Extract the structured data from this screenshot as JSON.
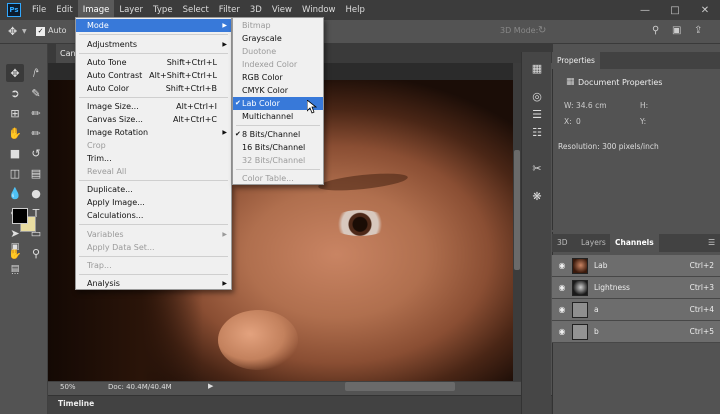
{
  "menubar": {
    "logo": "Ps",
    "items": [
      "File",
      "Edit",
      "Image",
      "Layer",
      "Type",
      "Select",
      "Filter",
      "3D",
      "View",
      "Window",
      "Help"
    ]
  },
  "options_bar": {
    "auto_label": "Auto",
    "mode_3d_label": "3D Mode:"
  },
  "document": {
    "tab_title": "Can",
    "zoom": "50%",
    "doc_size": "Doc: 40.4M/40.4M"
  },
  "image_menu": {
    "items": [
      {
        "label": "Mode",
        "shortcut": "",
        "submenu": true,
        "enabled": true,
        "highlighted": true
      },
      {
        "label": "Adjustments",
        "shortcut": "",
        "submenu": true,
        "enabled": true
      },
      {
        "label": "Auto Tone",
        "shortcut": "Shift+Ctrl+L",
        "enabled": true
      },
      {
        "label": "Auto Contrast",
        "shortcut": "Alt+Shift+Ctrl+L",
        "enabled": true
      },
      {
        "label": "Auto Color",
        "shortcut": "Shift+Ctrl+B",
        "enabled": true
      },
      {
        "label": "Image Size...",
        "shortcut": "Alt+Ctrl+I",
        "enabled": true
      },
      {
        "label": "Canvas Size...",
        "shortcut": "Alt+Ctrl+C",
        "enabled": true
      },
      {
        "label": "Image Rotation",
        "shortcut": "",
        "submenu": true,
        "enabled": true
      },
      {
        "label": "Crop",
        "shortcut": "",
        "enabled": false
      },
      {
        "label": "Trim...",
        "shortcut": "",
        "enabled": true
      },
      {
        "label": "Reveal All",
        "shortcut": "",
        "enabled": false
      },
      {
        "label": "Duplicate...",
        "shortcut": "",
        "enabled": true
      },
      {
        "label": "Apply Image...",
        "shortcut": "",
        "enabled": true
      },
      {
        "label": "Calculations...",
        "shortcut": "",
        "enabled": true
      },
      {
        "label": "Variables",
        "shortcut": "",
        "submenu": true,
        "enabled": false
      },
      {
        "label": "Apply Data Set...",
        "shortcut": "",
        "enabled": false
      },
      {
        "label": "Trap...",
        "shortcut": "",
        "enabled": false
      },
      {
        "label": "Analysis",
        "shortcut": "",
        "submenu": true,
        "enabled": true
      }
    ]
  },
  "mode_submenu": {
    "items": [
      {
        "label": "Bitmap",
        "enabled": false,
        "checked": false
      },
      {
        "label": "Grayscale",
        "enabled": true,
        "checked": false
      },
      {
        "label": "Duotone",
        "enabled": false,
        "checked": false
      },
      {
        "label": "Indexed Color",
        "enabled": false,
        "checked": false
      },
      {
        "label": "RGB Color",
        "enabled": true,
        "checked": false
      },
      {
        "label": "CMYK Color",
        "enabled": true,
        "checked": false
      },
      {
        "label": "Lab Color",
        "enabled": true,
        "checked": true,
        "highlighted": true
      },
      {
        "label": "Multichannel",
        "enabled": true,
        "checked": false
      },
      {
        "label": "8 Bits/Channel",
        "enabled": true,
        "checked": true
      },
      {
        "label": "16 Bits/Channel",
        "enabled": true,
        "checked": false
      },
      {
        "label": "32 Bits/Channel",
        "enabled": false,
        "checked": false
      },
      {
        "label": "Color Table...",
        "enabled": false,
        "checked": false
      }
    ]
  },
  "properties": {
    "tab": "Properties",
    "title": "Document Properties",
    "w_label": "W:",
    "w_value": "34.6 cm",
    "h_label": "H:",
    "x_label": "X:",
    "x_value": "0",
    "y_label": "Y:",
    "resolution": "Resolution: 300 pixels/inch"
  },
  "channels_panel": {
    "tabs": [
      "3D",
      "Layers",
      "Channels"
    ],
    "active_tab": "Channels",
    "rows": [
      {
        "name": "Lab",
        "shortcut": "Ctrl+2"
      },
      {
        "name": "Lightness",
        "shortcut": "Ctrl+3"
      },
      {
        "name": "a",
        "shortcut": "Ctrl+4"
      },
      {
        "name": "b",
        "shortcut": "Ctrl+5"
      }
    ]
  },
  "timeline": {
    "label": "Timeline"
  },
  "colors": {
    "menu_highlight": "#3879d9",
    "ps_blue": "#31a8ff",
    "background_swatch": "#e8dca0"
  }
}
